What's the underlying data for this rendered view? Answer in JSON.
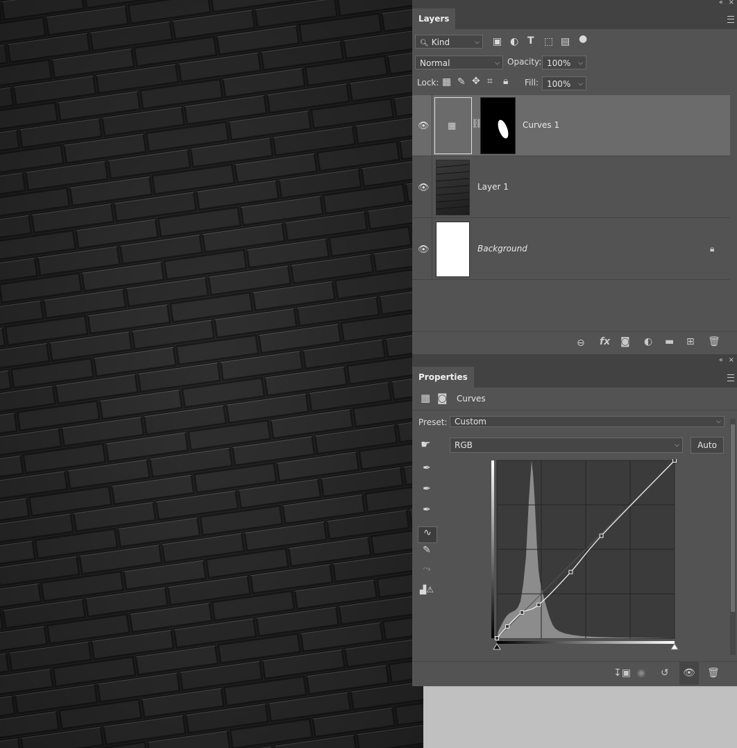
{
  "layers_panel": {
    "tab_label": "Layers",
    "filter_kind": "Kind",
    "blend_mode": "Normal",
    "opacity_label": "Opacity:",
    "opacity_value": "100%",
    "lock_label": "Lock:",
    "fill_label": "Fill:",
    "fill_value": "100%",
    "layers": [
      {
        "name": "Curves 1",
        "selected": true,
        "type": "adjustment",
        "visible": true
      },
      {
        "name": "Layer 1",
        "selected": false,
        "type": "pixel",
        "visible": true
      },
      {
        "name": "Background",
        "selected": false,
        "type": "background",
        "visible": true,
        "locked": true
      }
    ]
  },
  "properties_panel": {
    "tab_label": "Properties",
    "adjustment_title": "Curves",
    "preset_label": "Preset:",
    "preset_value": "Custom",
    "channel_value": "RGB",
    "auto_button": "Auto"
  },
  "curve": {
    "points": [
      [
        0,
        0
      ],
      [
        15,
        17
      ],
      [
        36,
        37
      ],
      [
        60,
        48
      ],
      [
        106,
        95
      ],
      [
        150,
        147
      ],
      [
        255,
        255
      ]
    ]
  },
  "colors": {
    "panel_bg": "#535353",
    "tabbar_bg": "#424242",
    "selected_layer_bg": "#6b6b6b",
    "canvas_bg": "#262626"
  }
}
